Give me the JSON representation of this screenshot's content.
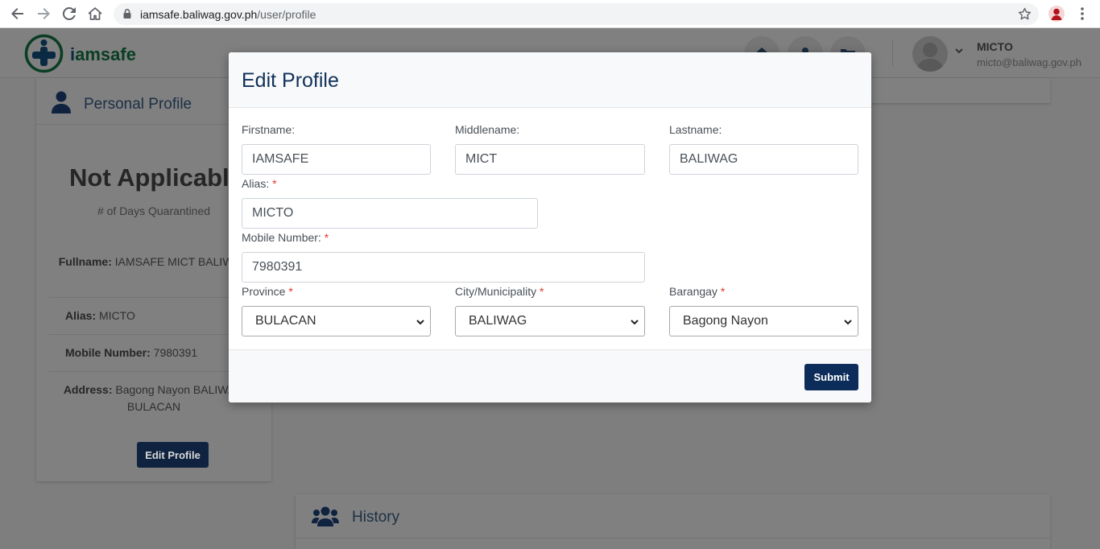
{
  "browser": {
    "url_host": "iamsafe.baliwag.gov.ph",
    "url_path": "/user/profile"
  },
  "app": {
    "logo_i": "i",
    "logo_rest": "amsafe",
    "brand_color": "#0a3d24",
    "header_icons": [
      "home-icon",
      "user-icon",
      "folder-icon"
    ],
    "user": {
      "name": "MICTO",
      "email": "micto@baliwag.gov.ph"
    }
  },
  "profile_card": {
    "title": "Personal Profile",
    "status": "Not Applicable",
    "status_caption": "# of Days Quarantined",
    "fullname_label": "Fullname:",
    "fullname_value": "IAMSAFE MICT BALIWAG",
    "alias_label": "Alias:",
    "alias_value": "MICTO",
    "mobile_label": "Mobile Number:",
    "mobile_value": "7980391",
    "address_label": "Address:",
    "address_value": "Bagong Nayon BALIWAG BULACAN",
    "edit_button": "Edit Profile"
  },
  "history_card": {
    "title": "History"
  },
  "modal": {
    "title": "Edit Profile",
    "fields": {
      "firstname": {
        "label": "Firstname:",
        "value": "IAMSAFE"
      },
      "middlename": {
        "label": "Middlename:",
        "value": "MICT"
      },
      "lastname": {
        "label": "Lastname:",
        "value": "BALIWAG"
      },
      "alias": {
        "label": "Alias:",
        "required_mark": "*",
        "value": "MICTO"
      },
      "mobile": {
        "label": "Mobile Number:",
        "required_mark": "*",
        "value": "7980391"
      },
      "province": {
        "label": "Province",
        "required_mark": "*",
        "value": "BULACAN"
      },
      "city": {
        "label": "City/Municipality",
        "required_mark": "*",
        "value": "BALIWAG"
      },
      "barangay": {
        "label": "Barangay",
        "required_mark": "*",
        "value": "Bagong Nayon"
      }
    },
    "submit_button": "Submit",
    "accent_color": "#0c2d5a"
  }
}
